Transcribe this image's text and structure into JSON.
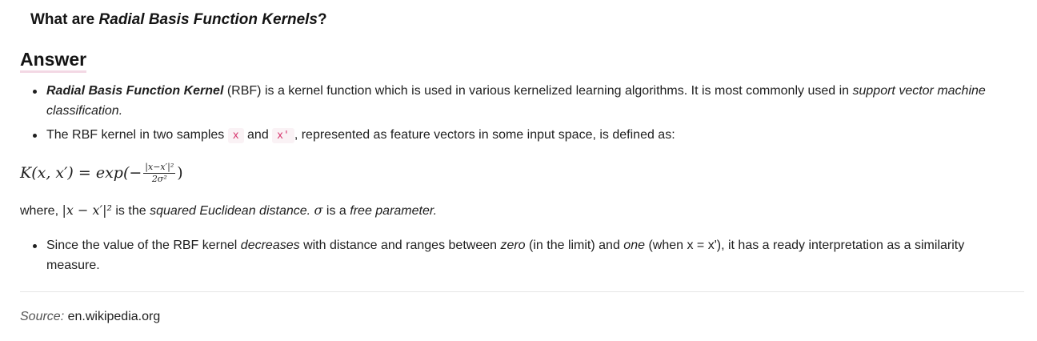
{
  "question": {
    "prefix": "What are ",
    "emphasis": "Radial Basis Function Kernels",
    "suffix": "?"
  },
  "answer_heading": "Answer",
  "bullets_top": [
    {
      "strong": "Radial Basis Function Kernel",
      "text1": " (RBF) is a kernel function which is used in various kernelized learning algorithms. It is most commonly used in ",
      "em": "support vector machine classification.",
      "text2": ""
    },
    {
      "text1": "The RBF kernel in two samples ",
      "code1": "x",
      "text2": " and ",
      "code2": "x'",
      "text3": ", represented as feature vectors in some input space, is defined as:"
    }
  ],
  "formula": {
    "lhs": "K(x, x′) = exp(−",
    "numerator": "|x−x′|²",
    "denominator": "2σ²",
    "close": ")"
  },
  "where_line": {
    "t1": "where, ",
    "m1": "|x − x′|²",
    "t2": " is the ",
    "em1": "squared Euclidean distance.",
    "t3": " ",
    "m2": "σ",
    "t4": " is a ",
    "em2": "free parameter."
  },
  "bullets_bottom": [
    {
      "t1": "Since the value of the RBF kernel ",
      "em1": "decreases",
      "t2": " with distance and ranges between ",
      "em2": "zero",
      "t3": " (in the limit) and ",
      "em3": "one",
      "t4": " (when x = x'), it has a ready interpretation as a similarity measure."
    }
  ],
  "source": {
    "label": "Source:",
    "link_text": "en.wikipedia.org"
  }
}
